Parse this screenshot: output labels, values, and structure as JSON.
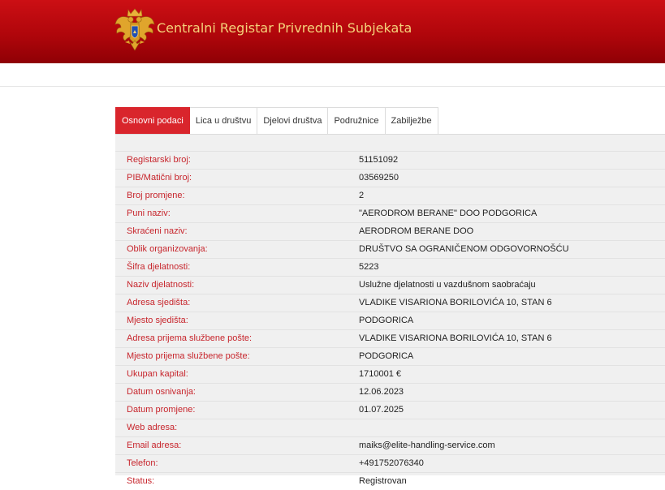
{
  "header": {
    "title": "Centralni Registar Privrednih Subjekata",
    "emblem_icon": "montenegro-coat-of-arms-icon"
  },
  "colors": {
    "header_red": "#b0060b",
    "accent_red": "#d9252c",
    "label_red": "#c7252c",
    "title_gold": "#f4d27a"
  },
  "tabs": [
    {
      "label": "Osnovni podaci",
      "active": true
    },
    {
      "label": "Lica u društvu",
      "active": false
    },
    {
      "label": "Djelovi društva",
      "active": false
    },
    {
      "label": "Podružnice",
      "active": false
    },
    {
      "label": "Zabilježbe",
      "active": false
    }
  ],
  "details": [
    {
      "label": "Registarski broj:",
      "value": "51151092"
    },
    {
      "label": "PIB/Matični broj:",
      "value": "03569250"
    },
    {
      "label": "Broj promjene:",
      "value": "2"
    },
    {
      "label": "Puni naziv:",
      "value": "\"AERODROM BERANE\" DOO PODGORICA"
    },
    {
      "label": "Skraćeni naziv:",
      "value": "AERODROM BERANE DOO"
    },
    {
      "label": "Oblik organizovanja:",
      "value": "DRUŠTVO SA OGRANIČENOM ODGOVORNOŠĆU"
    },
    {
      "label": "Šifra djelatnosti:",
      "value": "5223"
    },
    {
      "label": "Naziv djelatnosti:",
      "value": "Uslužne djelatnosti u vazdušnom saobraćaju"
    },
    {
      "label": "Adresa sjedišta:",
      "value": "VLADIKE VISARIONA BORILOVIĆA 10, STAN 6"
    },
    {
      "label": "Mjesto sjedišta:",
      "value": "PODGORICA"
    },
    {
      "label": "Adresa prijema službene pošte:",
      "value": "VLADIKE VISARIONA BORILOVIĆA 10, STAN 6"
    },
    {
      "label": "Mjesto prijema službene pošte:",
      "value": "PODGORICA"
    },
    {
      "label": "Ukupan kapital:",
      "value": "1710001 €"
    },
    {
      "label": "Datum osnivanja:",
      "value": "12.06.2023"
    },
    {
      "label": "Datum promjene:",
      "value": "01.07.2025"
    },
    {
      "label": "Web adresa:",
      "value": ""
    },
    {
      "label": "Email adresa:",
      "value": "maiks@elite-handling-service.com"
    },
    {
      "label": "Telefon:",
      "value": "+491752076340"
    },
    {
      "label": "Status:",
      "value": "Registrovan"
    }
  ]
}
